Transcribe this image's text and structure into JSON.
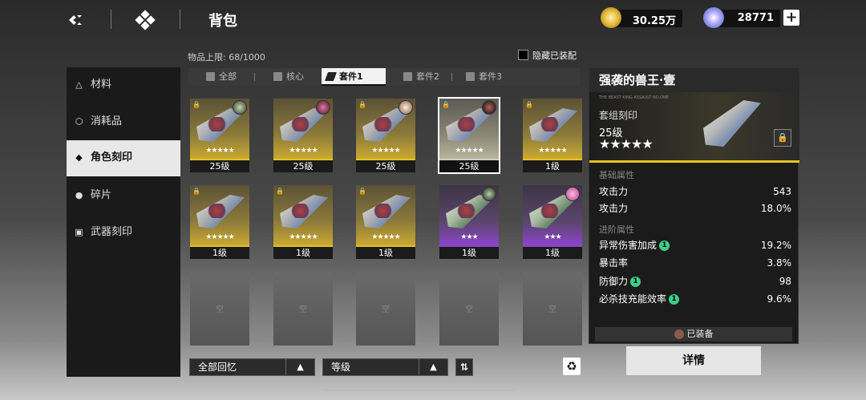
{
  "header": {
    "title": "背包",
    "currency1": "30.25万",
    "currency2": "28771",
    "plus": "+"
  },
  "inventory": {
    "capacity": "物品上限: 68/1000",
    "hide_equipped": "隐藏已装配"
  },
  "sidebar": {
    "items": [
      {
        "label": "材料",
        "icon": "△"
      },
      {
        "label": "消耗品",
        "icon": "⬡"
      },
      {
        "label": "角色刻印",
        "icon": "◆"
      },
      {
        "label": "碎片",
        "icon": "●"
      },
      {
        "label": "武器刻印",
        "icon": "▣"
      }
    ]
  },
  "tabs": [
    {
      "label": "全部"
    },
    {
      "label": "核心"
    },
    {
      "label": "套件1"
    },
    {
      "label": "套件2"
    },
    {
      "label": "套件3"
    }
  ],
  "cards_row1": [
    {
      "stars": "★★★★★",
      "level": "25级"
    },
    {
      "stars": "★★★★★",
      "level": "25级"
    },
    {
      "stars": "★★★★★",
      "level": "25级"
    },
    {
      "stars": "★★★★★",
      "level": "25级"
    },
    {
      "stars": "★★★★★",
      "level": "1级"
    }
  ],
  "cards_row2": [
    {
      "stars": "★★★★★",
      "level": "1级"
    },
    {
      "stars": "★★★★★",
      "level": "1级"
    },
    {
      "stars": "★★★★★",
      "level": "1级"
    },
    {
      "stars": "★★★",
      "level": "1级"
    },
    {
      "stars": "★★★",
      "level": "1级"
    }
  ],
  "empty_label": "空",
  "controls": {
    "filter": "全部回忆",
    "sort": "等级",
    "arrow": "▲",
    "swap": "⇅",
    "recycle": "♻"
  },
  "detail": {
    "title": "强袭的兽王·壹",
    "tinytxt": "THE BEAST KING ASSAULT NO.ONE",
    "type": "套组刻印",
    "level": "25级",
    "stars": "★★★★★",
    "basic_header": "基础属性",
    "basic": [
      {
        "name": "攻击力",
        "value": "543"
      },
      {
        "name": "攻击力",
        "value": "18.0%"
      }
    ],
    "adv_header": "进阶属性",
    "advanced": [
      {
        "name": "异常伤害加成",
        "badge": "1",
        "value": "19.2%"
      },
      {
        "name": "暴击率",
        "badge": "",
        "value": "3.8%"
      },
      {
        "name": "防御力",
        "badge": "1",
        "value": "98"
      },
      {
        "name": "必杀技充能效率",
        "badge": "1",
        "value": "9.6%"
      }
    ],
    "equipped": "已装备",
    "details_button": "详情"
  },
  "colors": {
    "gold": "#e6c31e",
    "purple": "#8a45c8",
    "badge": "#3ccf8a"
  }
}
